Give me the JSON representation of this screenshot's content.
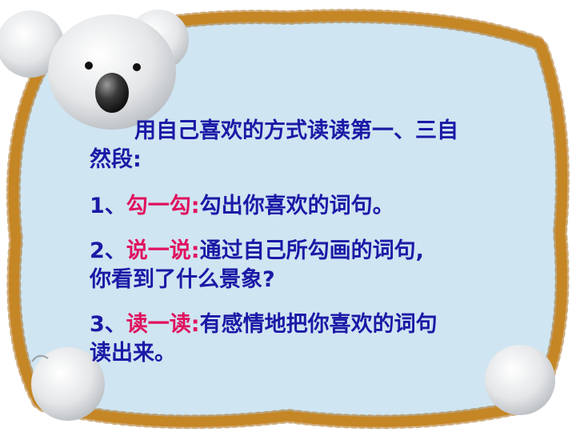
{
  "intro": {
    "line1": "用自己喜欢的方式读读第一、三自",
    "line2": "然段:"
  },
  "items": [
    {
      "num": "1、",
      "keyword": "勾一勾:",
      "text": "勾出你喜欢的词句。",
      "text2": ""
    },
    {
      "num": "2、",
      "keyword": "说一说:",
      "text": "通过自己所勾画的词句,",
      "text2": "你看到了什么景象?"
    },
    {
      "num": "3、",
      "keyword": "读一读:",
      "text": "有感情地把你喜欢的词句",
      "text2": "读出来。"
    }
  ],
  "colors": {
    "main_text": "#1a1aa6",
    "keyword": "#e0125f",
    "panel": "#cfe5f2",
    "frame": "#c7861f"
  }
}
